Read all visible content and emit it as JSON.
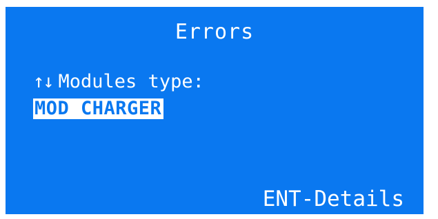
{
  "screen": {
    "title": "Errors",
    "nav_arrows": "↑↓",
    "prompt_label": "Modules type:",
    "selected_value": "MOD CHARGER",
    "footer_hint": "ENT-Details"
  },
  "colors": {
    "background": "#0a78f0",
    "foreground": "#ffffff",
    "frame": "#ffffff"
  }
}
